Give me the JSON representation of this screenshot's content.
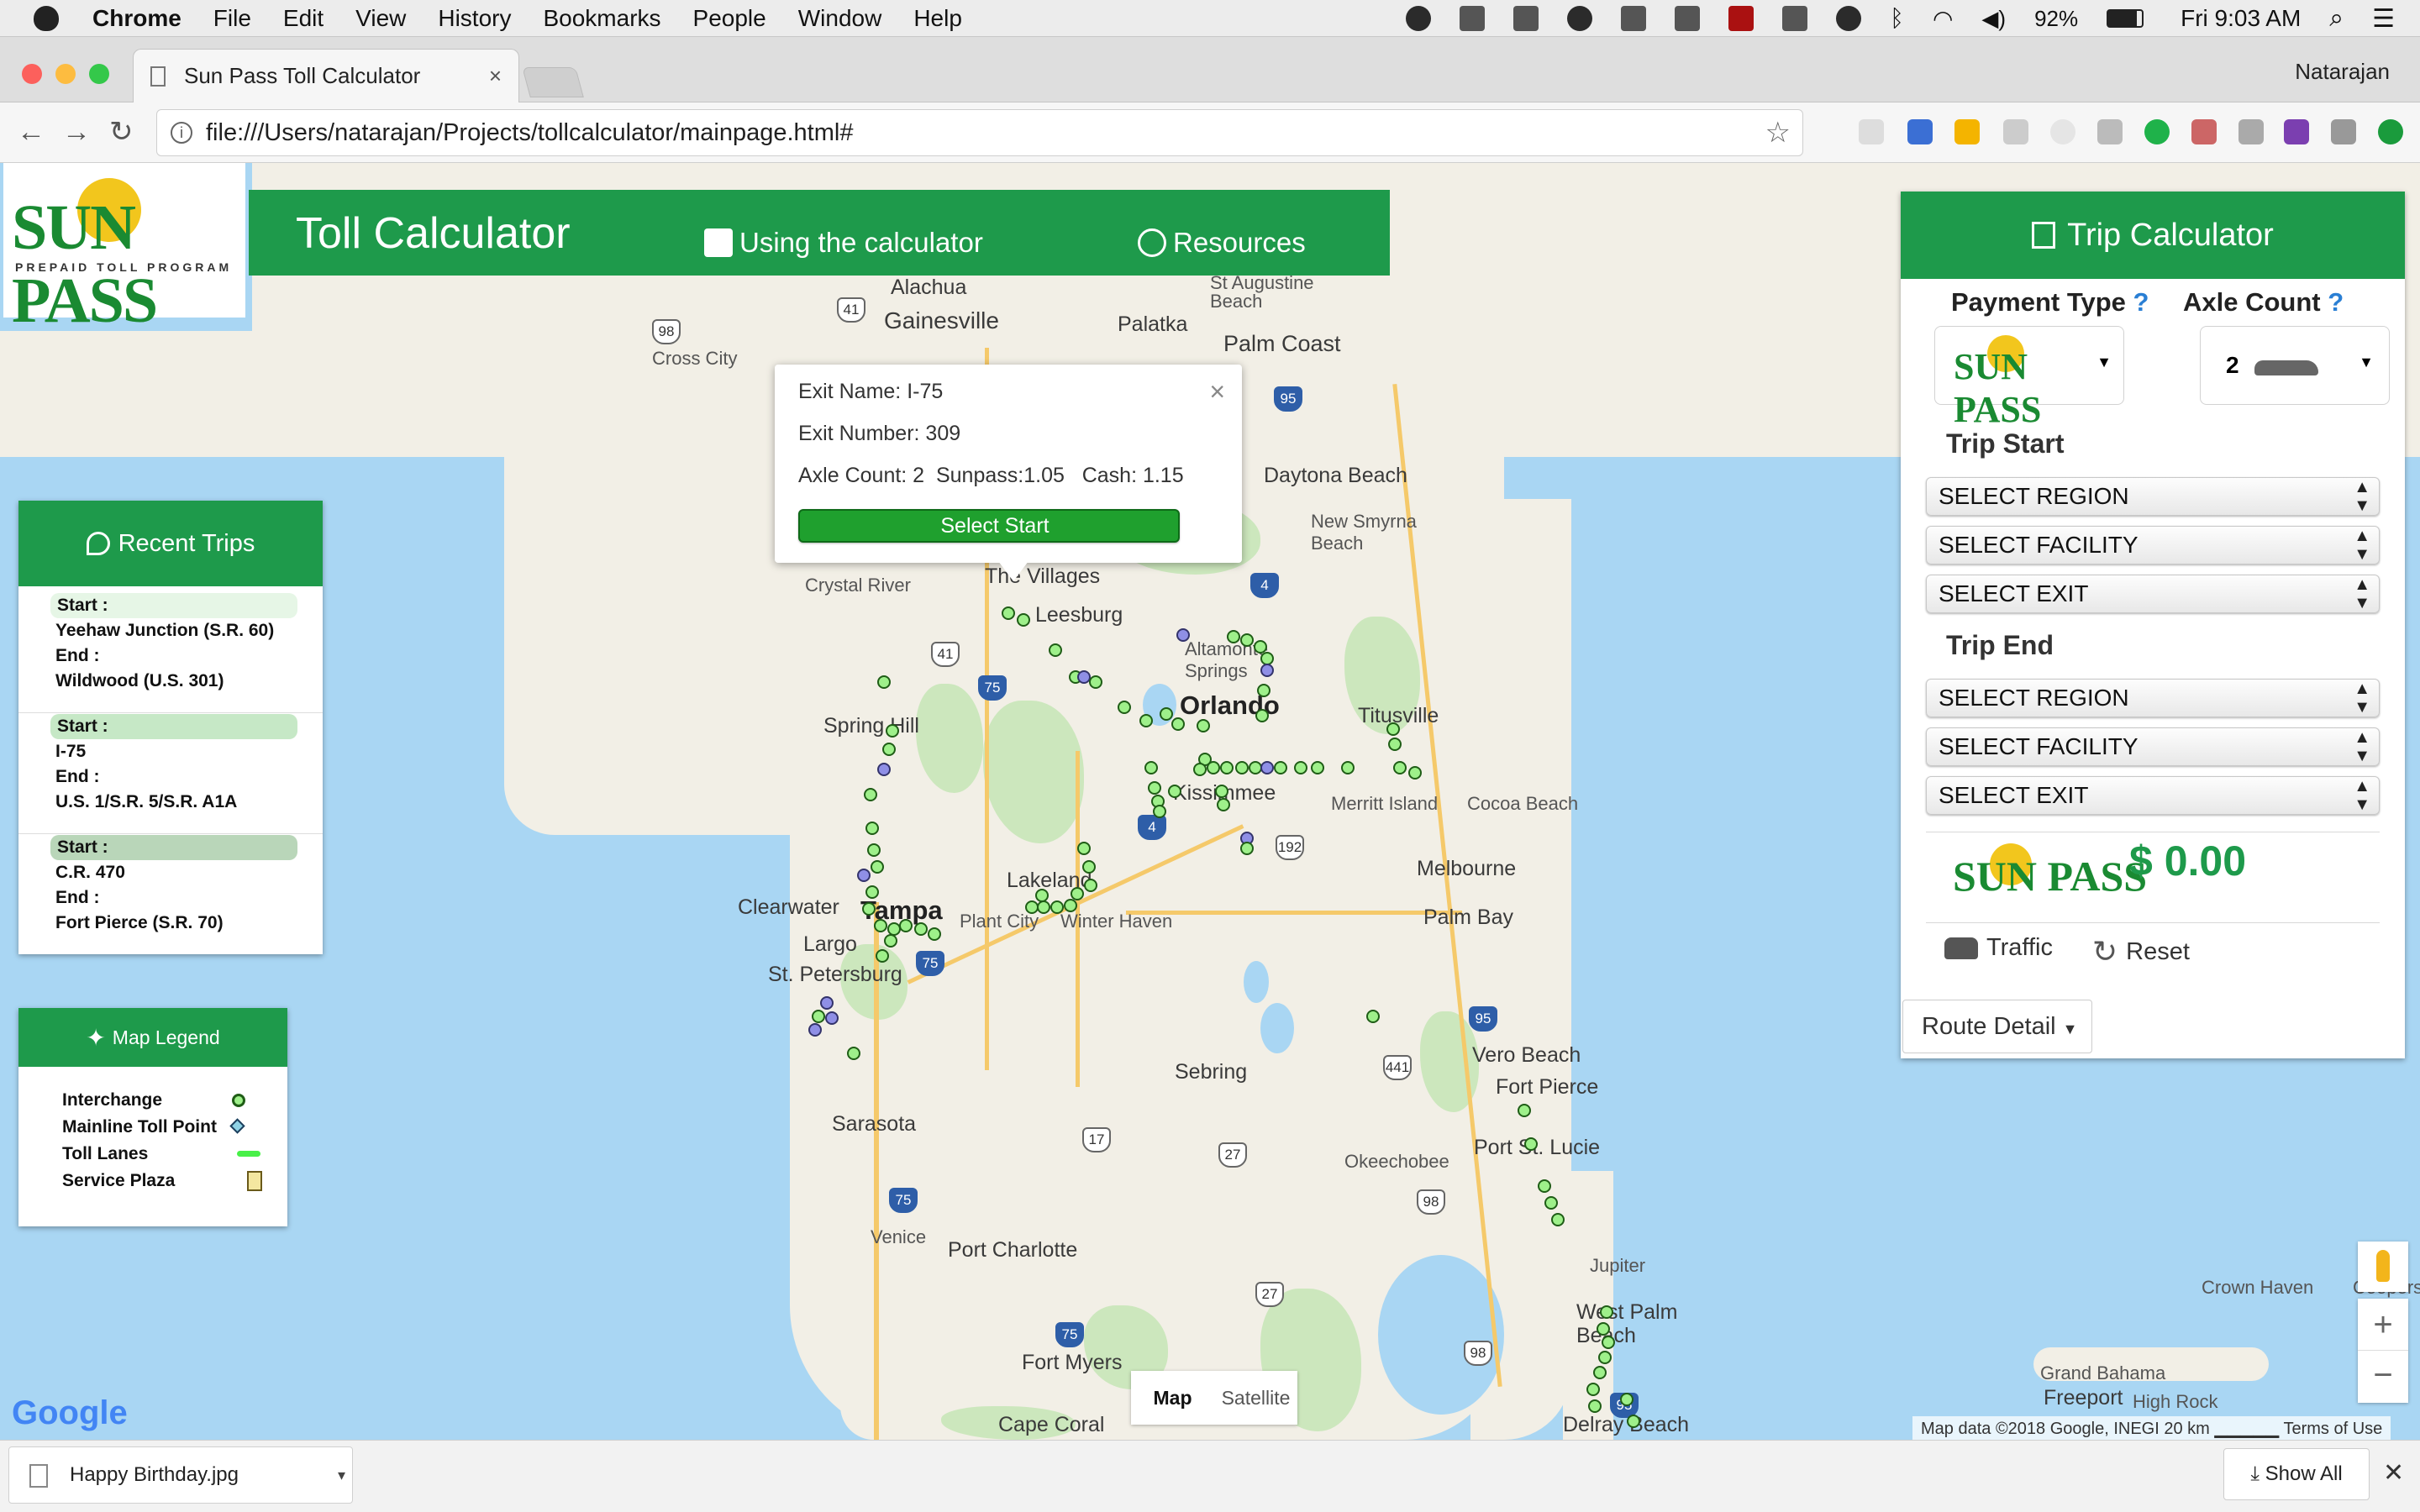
{
  "menubar": {
    "app": "Chrome",
    "items": [
      "File",
      "Edit",
      "View",
      "History",
      "Bookmarks",
      "People",
      "Window",
      "Help"
    ],
    "battery": "92%",
    "clock": "Fri 9:03 AM"
  },
  "browser": {
    "tab_title": "Sun Pass Toll Calculator",
    "profile_name": "Natarajan",
    "url": "file:///Users/natarajan/Projects/tollcalculator/mainpage.html#"
  },
  "header": {
    "logo_word": "SUN PASS",
    "logo_tagline": "PREPAID TOLL PROGRAM",
    "title": "Toll Calculator",
    "link_using": "Using the calculator",
    "link_resources": "Resources"
  },
  "popup": {
    "exit_name": "Exit Name: I-75",
    "exit_number": "Exit Number: 309",
    "axle_info": "Axle Count: 2  Sunpass:1.05   Cash: 1.15",
    "select_button": "Select Start",
    "close": "×"
  },
  "recent_trips": {
    "title": "Recent Trips",
    "trips": [
      {
        "start_label": "Start :",
        "start": "Yeehaw Junction (S.R. 60)",
        "end_label": "End :",
        "end": "Wildwood (U.S. 301)",
        "label_bg": "#e6f6e6"
      },
      {
        "start_label": "Start :",
        "start": "I-75",
        "end_label": "End :",
        "end": "U.S. 1/S.R. 5/S.R. A1A",
        "label_bg": "#c6e8c6"
      },
      {
        "start_label": "Start :",
        "start": "C.R. 470",
        "end_label": "End :",
        "end": "Fort Pierce (S.R. 70)",
        "label_bg": "#b9d6b9"
      }
    ]
  },
  "legend": {
    "title": "Map Legend",
    "items": [
      "Interchange",
      "Mainline Toll Point",
      "Toll Lanes",
      "Service Plaza"
    ]
  },
  "calculator": {
    "title": "Trip Calculator",
    "payment_type_label": "Payment Type",
    "axle_count_label": "Axle Count",
    "help_mark": "?",
    "axle_value": "2",
    "trip_start": "Trip Start",
    "trip_end": "Trip End",
    "select_region": "SELECT REGION",
    "select_facility": "SELECT FACILITY",
    "select_exit": "SELECT EXIT",
    "amount": "$ 0.00",
    "traffic": "Traffic",
    "reset": "Reset",
    "route_detail": "Route Detail"
  },
  "map": {
    "cities": {
      "gainesville": "Gainesville",
      "alachua": "Alachua",
      "palatka": "Palatka",
      "st_augustine": "St Augustine Beach",
      "palm_coast": "Palm Coast",
      "cross_city": "Cross City",
      "daytona": "Daytona Beach",
      "new_smyrna": "New Smyrna Beach",
      "crystal_river": "Crystal River",
      "villages": "The Villages",
      "leesburg": "Leesburg",
      "altamonte": "Altamonte Springs",
      "orlando": "Orlando",
      "spring_hill": "Spring Hill",
      "titusville": "Titusville",
      "kissimmee": "Kissimmee",
      "merritt": "Merritt Island",
      "cocoa": "Cocoa Beach",
      "clearwater": "Clearwater",
      "tampa": "Tampa",
      "lakeland": "Lakeland",
      "plant_city": "Plant City",
      "winter_haven": "Winter Haven",
      "largo": "Largo",
      "st_pete": "St. Petersburg",
      "melbourne": "Melbourne",
      "palm_bay": "Palm Bay",
      "sebring": "Sebring",
      "vero": "Vero Beach",
      "fort_pierce": "Fort Pierce",
      "sarasota": "Sarasota",
      "port_st_lucie": "Port St. Lucie",
      "okeechobee": "Okeechobee",
      "venice": "Venice",
      "port_charlotte": "Port Charlotte",
      "jupiter": "Jupiter",
      "west_palm": "West Palm Beach",
      "fort_myers": "Fort Myers",
      "cape_coral": "Cape Coral",
      "delray": "Delray Beach",
      "crown_haven": "Crown Haven",
      "coopers": "Coopers",
      "grand_bahama": "Grand Bahama",
      "freeport": "Freeport",
      "high_rock": "High Rock"
    },
    "map_button": "Map",
    "satellite_button": "Satellite",
    "google_logo": "Google",
    "attribution": "Map data ©2018 Google, INEGI   20 km ▁▁▁▁▁   Terms of Use"
  },
  "downloads": {
    "file": "Happy Birthday.jpg",
    "show_all": "Show All"
  },
  "colors": {
    "brand_green": "#1e9a4b",
    "sun_yellow": "#f2c61d",
    "interchange_dot": "#9ef08a",
    "toll_point_dot": "#8f8fe6"
  }
}
